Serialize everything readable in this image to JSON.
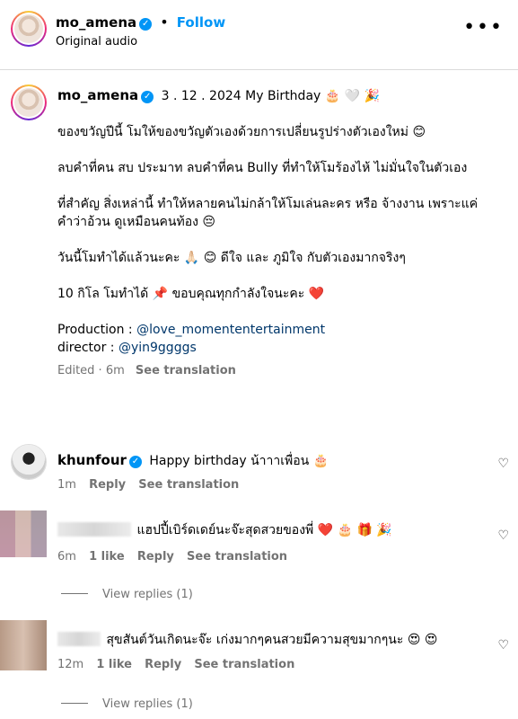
{
  "header": {
    "username": "mo_amena",
    "follow_label": "Follow",
    "subtitle": "Original audio",
    "more_icon": "more-horizontal-icon"
  },
  "caption": {
    "username": "mo_amena",
    "title": "3 . 12 . 2024 My Birthday 🎂 🤍 🎉",
    "lines": [
      "ของขวัญปีนี้ โมให้ของขวัญตัวเองด้วยการเปลี่ยนรูปร่างตัวเองใหม่ 😊",
      "ลบคำที่คน สบ ประมาท ลบคำที่คน Bully ที่ทำให้โมร้องไห้ ไม่มั่นใจในตัวเอง",
      "ที่สำคัญ สิ่งเหล่านี้ ทำให้หลายคนไม่กล้าให้โมเล่นละคร หรือ จ้างงาน เพราะแค่คำว่าอ้วน ดูเหมือนคนท้อง 😔",
      "วันนี้โมทำได้แล้วนะคะ 🙏🏻 😊 ดีใจ และ ภูมิใจ กับตัวเองมากจริงๆ",
      "10 กิโล โมทำได้ 📌 ขอบคุณทุกกำลังใจนะคะ ❤️"
    ],
    "production_label": "Production :",
    "production_link": "@love_momententertainment",
    "director_label": "director :",
    "director_link": "@yin9ggggs",
    "edited": "Edited · 6m",
    "see_translation": "See translation"
  },
  "comments": [
    {
      "username": "khunfour",
      "text": "Happy birthday น้าาาเพื่อน 🎂",
      "time": "1m",
      "reply": "Reply",
      "see_translation": "See translation"
    },
    {
      "username": "",
      "text": "แฮปปี้เบิร์ดเดย์นะจ๊ะสุดสวยของพี่ ❤️ 🎂 🎁 🎉",
      "time": "6m",
      "likes": "1 like",
      "reply": "Reply",
      "see_translation": "See translation",
      "view_replies": "View replies (1)"
    },
    {
      "username": "",
      "text": "สุขสันต์วันเกิดนะจ๊ะ เก่งมากๆคนสวยมีความสุขมากๆนะ 😍 😍",
      "time": "12m",
      "likes": "1 like",
      "reply": "Reply",
      "see_translation": "See translation",
      "view_replies": "View replies (1)"
    }
  ]
}
